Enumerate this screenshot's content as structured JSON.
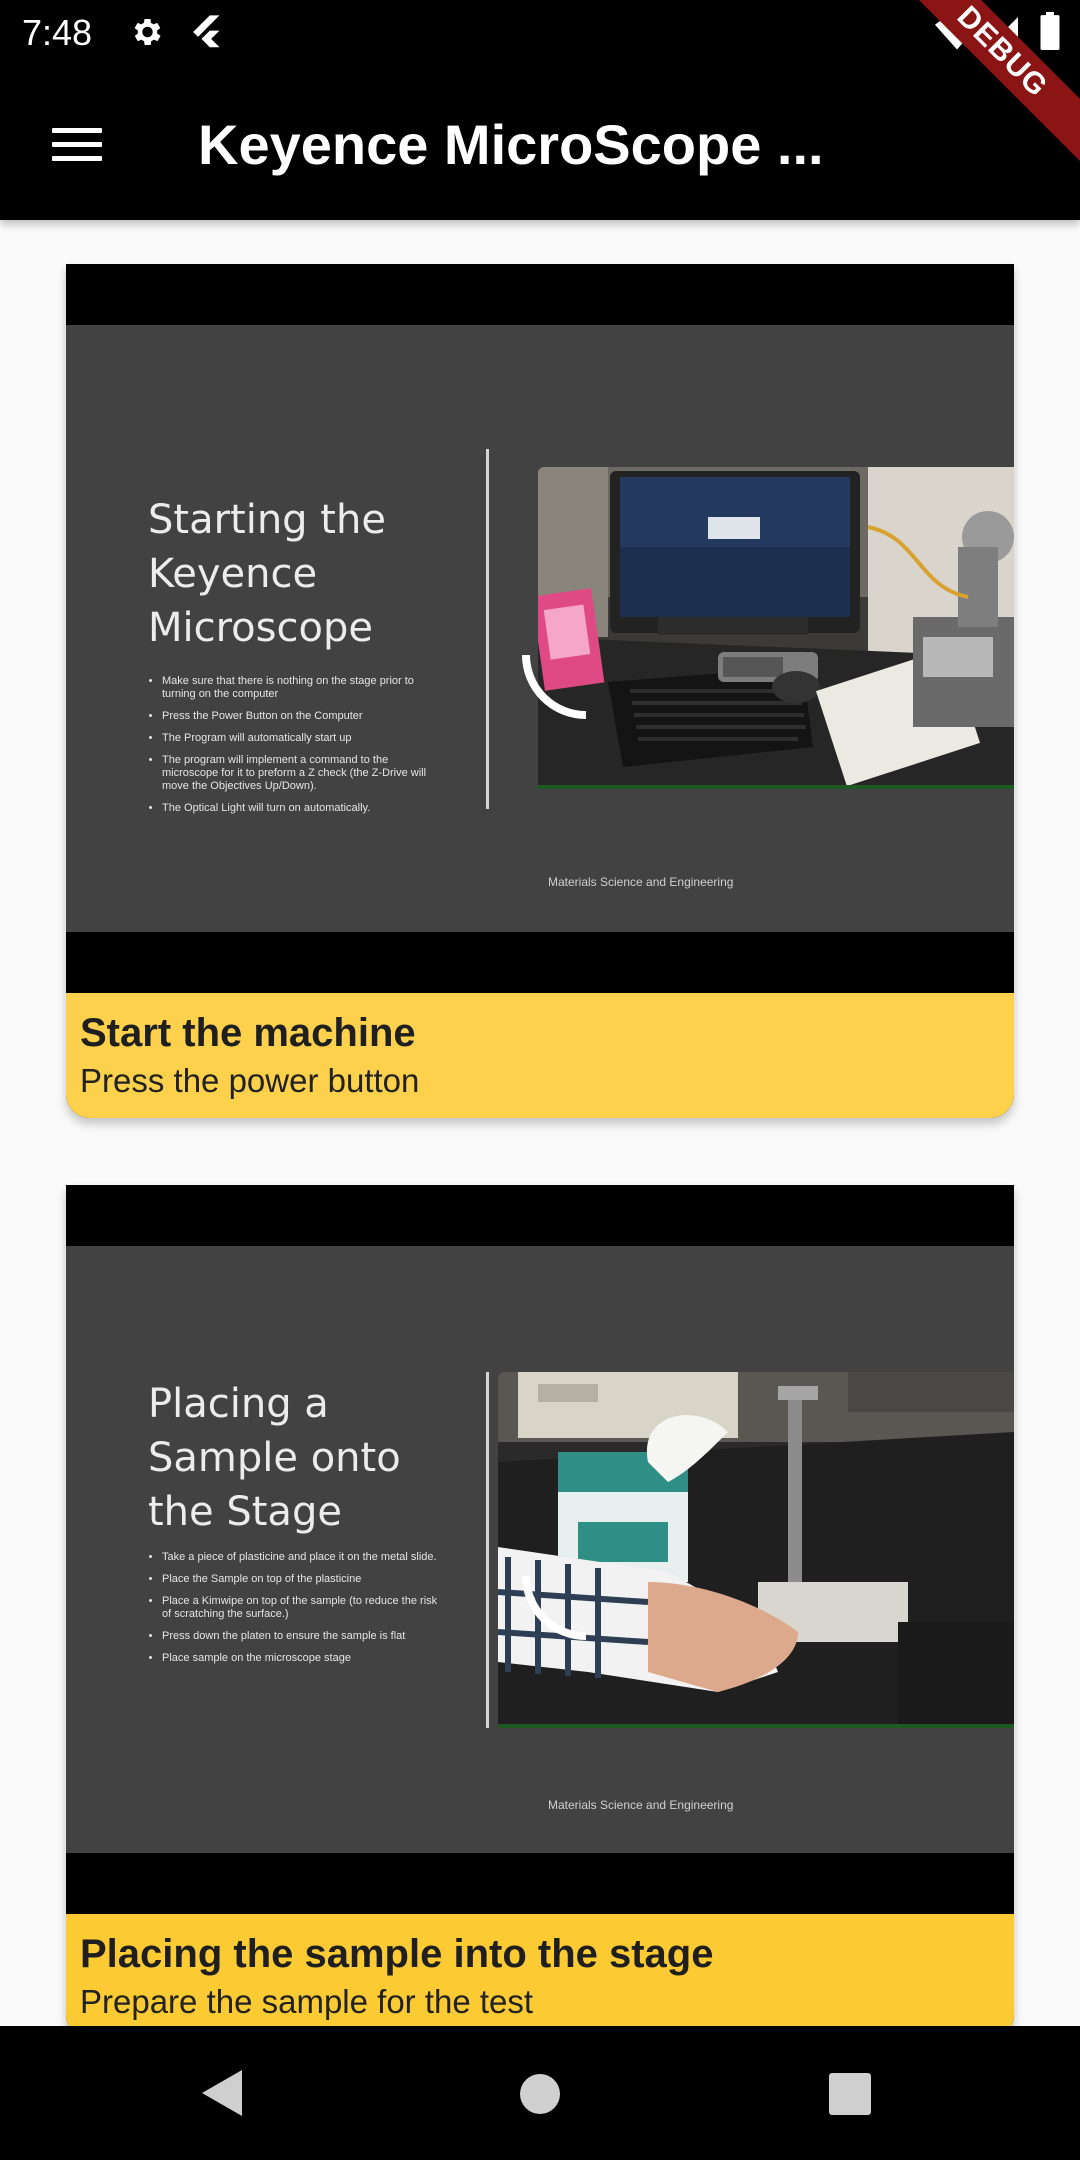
{
  "status_bar": {
    "time": "7:48",
    "icons": [
      "gear-icon",
      "flutter-icon",
      "wifi-icon",
      "signal-icon",
      "battery-icon"
    ],
    "debug_label": "DEBUG"
  },
  "app_bar": {
    "title": "Keyence MicroScope ...",
    "menu_icon": "menu-icon"
  },
  "cards": [
    {
      "slide": {
        "title": "Starting the\nKeyence\nMicroscope",
        "bullets": [
          "Make sure that there is nothing on the stage prior to turning on the computer",
          "Press the Power Button on the Computer",
          "The Program will automatically start up",
          "The program will implement a command to the microscope for it to preform a Z check (the Z-Drive will move the Objectives Up/Down).",
          "The Optical Light will turn on automatically."
        ],
        "footer": "Materials Science and Engineering"
      },
      "title": "Start the machine",
      "subtitle": "Press the power button"
    },
    {
      "slide": {
        "title": "Placing a\nSample onto\nthe Stage",
        "bullets": [
          "Take a piece of plasticine and place it on the metal slide.",
          "Place the Sample on top of the plasticine",
          "Place a Kimwipe on top of the sample (to reduce the risk of scratching the surface.)",
          "Press down the platen to ensure the sample is flat",
          "Place sample on the microscope stage"
        ],
        "footer": "Materials Science and Engineering"
      },
      "title": "Placing the sample into the stage",
      "subtitle": "Prepare the sample for the test"
    }
  ],
  "nav_bar": {
    "icons": [
      "back-icon",
      "home-icon",
      "recents-icon"
    ]
  },
  "colors": {
    "caption_card_1": "#fdd14c",
    "caption_card_2": "#fcca33",
    "debug_ribbon": "#8b1414",
    "slide_background": "#424242"
  }
}
